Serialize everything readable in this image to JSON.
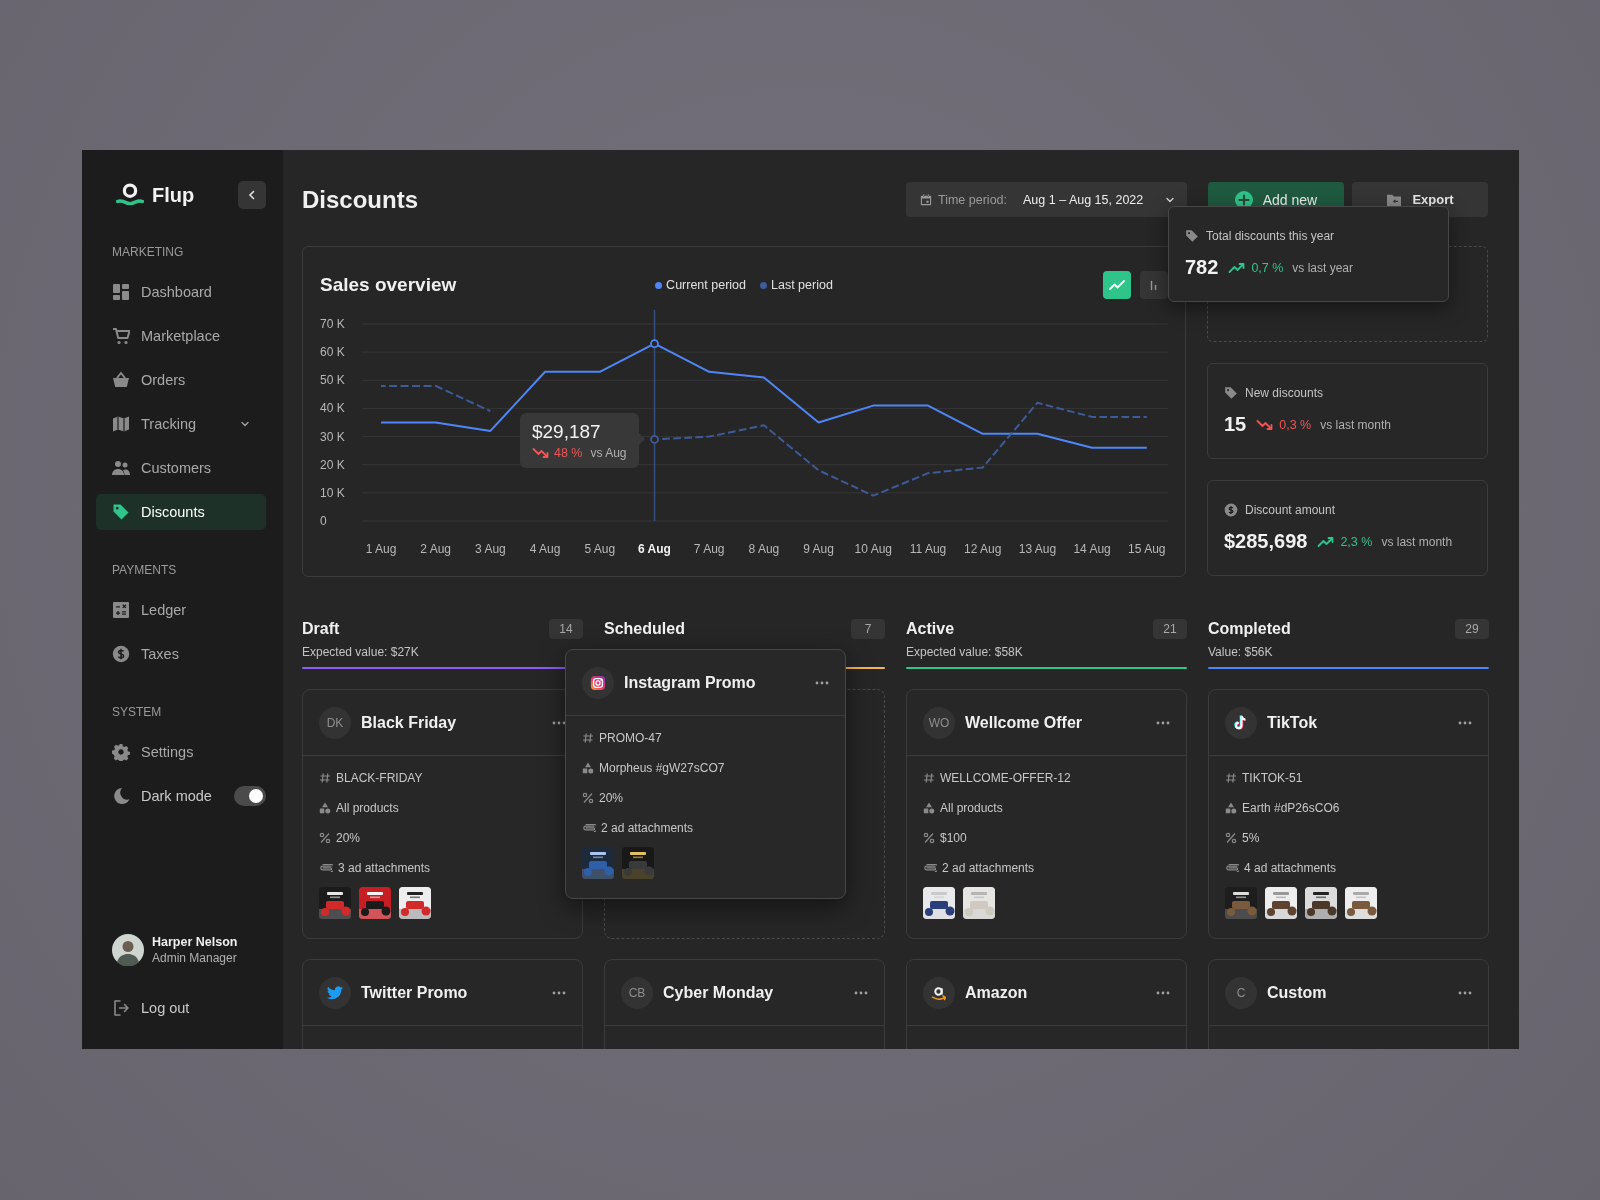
{
  "app": {
    "name": "Flup"
  },
  "sidebar": {
    "sections": [
      {
        "title": "MARKETING",
        "items": [
          {
            "kind": "link",
            "label": "Dashboard",
            "selected": false
          },
          {
            "kind": "link",
            "label": "Marketplace",
            "selected": false
          },
          {
            "kind": "link",
            "label": "Orders",
            "selected": false
          },
          {
            "kind": "group",
            "label": "Tracking",
            "selected": false,
            "expanded": false
          },
          {
            "kind": "link",
            "label": "Customers",
            "selected": false
          },
          {
            "kind": "link",
            "label": "Discounts",
            "selected": true
          }
        ]
      },
      {
        "title": "PAYMENTS",
        "items": [
          {
            "kind": "link",
            "label": "Ledger",
            "selected": false
          },
          {
            "kind": "link",
            "label": "Taxes",
            "selected": false
          }
        ]
      },
      {
        "title": "SYSTEM",
        "items": [
          {
            "kind": "link",
            "label": "Settings",
            "selected": false
          },
          {
            "kind": "toggle",
            "label": "Dark mode",
            "on": true
          }
        ]
      }
    ]
  },
  "user": {
    "name": "Harper Nelson",
    "role": "Admin Manager"
  },
  "logout": {
    "label": "Log out"
  },
  "header": {
    "title": "Discounts",
    "period": {
      "label": "Time period:",
      "value": "Aug 1 – Aug 15, 2022"
    },
    "buttons": [
      {
        "kind": "primary",
        "label": "Add new"
      },
      {
        "kind": "secondary",
        "label": "Export"
      }
    ]
  },
  "sales_overview": {
    "title": "Sales overview",
    "view_toggles": [
      {
        "kind": "line",
        "selected": true
      },
      {
        "kind": "bar",
        "selected": false
      }
    ],
    "chart_data": {
      "type": "line",
      "categories": [
        "1 Aug",
        "2 Aug",
        "3 Aug",
        "4 Aug",
        "5 Aug",
        "6 Aug",
        "7 Aug",
        "8 Aug",
        "9 Aug",
        "10 Aug",
        "11 Aug",
        "12 Aug",
        "13 Aug",
        "14 Aug",
        "15 Aug"
      ],
      "series": [
        {
          "name": "Current period",
          "color": "#4f86f7",
          "line_style": "solid",
          "values": [
            35000,
            35000,
            32000,
            53000,
            53000,
            63000,
            53000,
            51000,
            35000,
            41000,
            41000,
            31000,
            31000,
            26000,
            26000
          ]
        },
        {
          "name": "Last period",
          "color": "#3d5a99",
          "line_style": "dashed",
          "values": [
            48000,
            48000,
            39000,
            null,
            null,
            29000,
            30000,
            34000,
            18000,
            9000,
            17000,
            19000,
            42000,
            37000,
            37000
          ]
        }
      ],
      "ylim": [
        0,
        70000
      ],
      "yticks": [
        {
          "value": 0,
          "label": "0"
        },
        {
          "value": 10000,
          "label": "10 K"
        },
        {
          "value": 20000,
          "label": "20 K"
        },
        {
          "value": 30000,
          "label": "30 K"
        },
        {
          "value": 40000,
          "label": "40 K"
        },
        {
          "value": 50000,
          "label": "50 K"
        },
        {
          "value": 60000,
          "label": "60 K"
        },
        {
          "value": 70000,
          "label": "70 K"
        }
      ],
      "grid": true,
      "ref_lines": [
        {
          "axis": "x",
          "value": "6 Aug"
        }
      ],
      "annotations": [
        {
          "x": "6 Aug",
          "text": "$29,187"
        }
      ]
    },
    "tooltip": {
      "change": "48 %",
      "rising": false,
      "compare": "vs Aug"
    }
  },
  "stats": [
    {
      "kind": "count",
      "label": "Total discounts this year",
      "value": "782",
      "change": "0,7 %",
      "rising": true,
      "compare": "vs last year",
      "dragging": true
    },
    {
      "kind": "count",
      "label": "New discounts",
      "value": "15",
      "change": "0,3 %",
      "rising": false,
      "compare": "vs last month",
      "dragging": false
    },
    {
      "kind": "amount",
      "label": "Discount amount",
      "value": "$285,698",
      "change": "2,3 %",
      "rising": true,
      "compare": "vs last month",
      "dragging": false
    }
  ],
  "columns": [
    {
      "title": "Draft",
      "count": "14",
      "subtitle": "Expected value: $27K",
      "color": "#8b5cf6",
      "cards": [
        {
          "title": "Black Friday",
          "avatar": {
            "kind": "initials",
            "text": "DK"
          },
          "code": "BLACK-FRIDAY",
          "scope": "All products",
          "discount": "20%",
          "attachments": "3 ad attachments",
          "dragging": false
        },
        {
          "title": "Twitter Promo",
          "avatar": {
            "kind": "twitter"
          },
          "dragging": false
        }
      ]
    },
    {
      "title": "Scheduled",
      "count": "7",
      "color": "#f5b454",
      "cards": [
        {
          "title": "Instagram Promo",
          "avatar": {
            "kind": "instagram"
          },
          "code": "PROMO-47",
          "scope": "Morpheus #gW27sCO7",
          "discount": "20%",
          "attachments": "2 ad attachments",
          "dragging": true
        },
        {
          "title": "Cyber Monday",
          "avatar": {
            "kind": "initials",
            "text": "CB"
          },
          "dragging": false
        }
      ]
    },
    {
      "title": "Active",
      "count": "21",
      "subtitle": "Expected value: $58K",
      "color": "#2fc48a",
      "cards": [
        {
          "title": "Wellcome Offer",
          "avatar": {
            "kind": "initials",
            "text": "WO"
          },
          "code": "WELLCOME-OFFER-12",
          "scope": "All products",
          "discount": "$100",
          "attachments": "2 ad attachments",
          "dragging": false
        },
        {
          "title": "Amazon",
          "avatar": {
            "kind": "amazon"
          },
          "dragging": false
        }
      ]
    },
    {
      "title": "Completed",
      "count": "29",
      "subtitle": "Value: $56K",
      "color": "#4f86f7",
      "cards": [
        {
          "title": "TikTok",
          "avatar": {
            "kind": "tiktok"
          },
          "code": "TIKTOK-51",
          "scope": "Earth #dP26sCO6",
          "discount": "5%",
          "attachments": "4 ad attachments",
          "dragging": false
        },
        {
          "title": "Custom",
          "avatar": {
            "kind": "initials",
            "text": "C"
          },
          "dragging": false
        }
      ]
    }
  ]
}
